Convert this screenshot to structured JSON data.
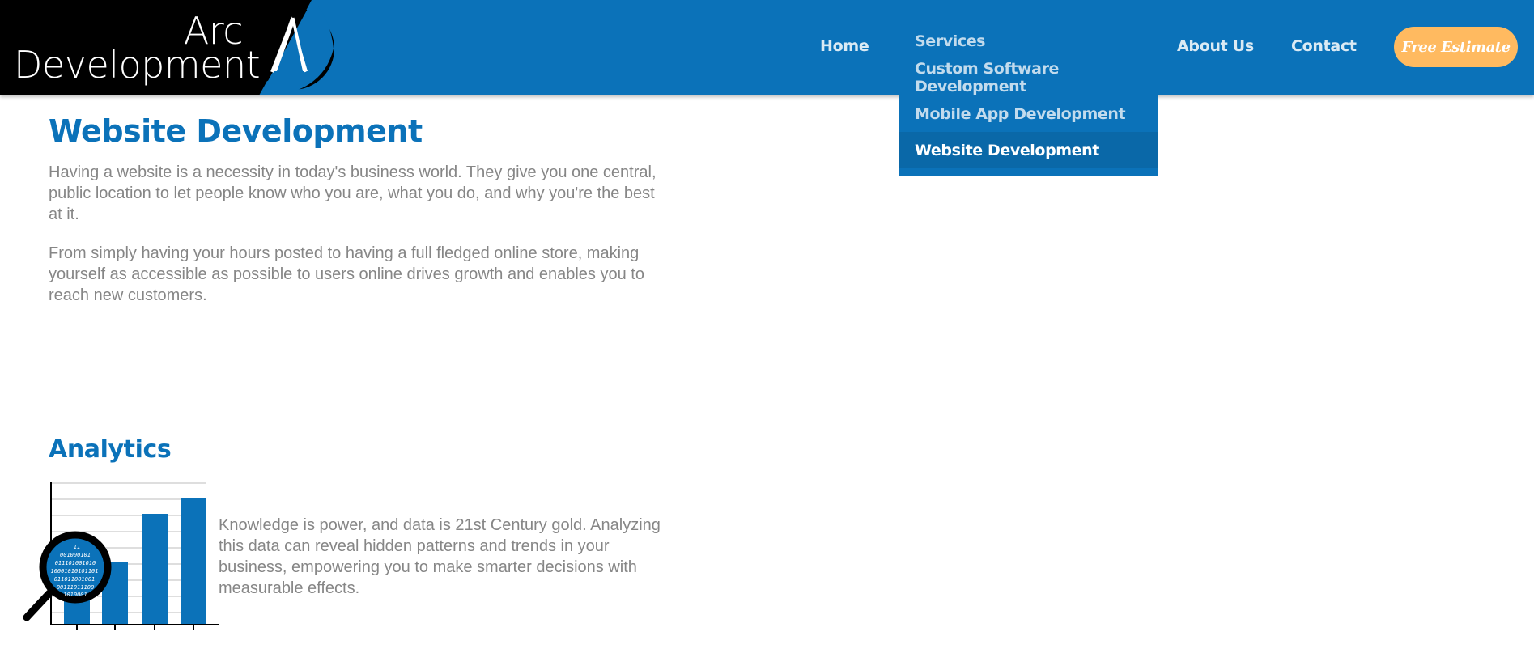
{
  "header": {
    "logo": {
      "line1": "Arc",
      "line2": "Development"
    },
    "tabs": [
      {
        "label": "Home"
      },
      {
        "label": "About Us"
      },
      {
        "label": "Contact"
      }
    ],
    "estimate_button": "Free Estimate"
  },
  "services_menu": {
    "items": [
      {
        "label": "Services"
      },
      {
        "label": "Custom Software Development"
      },
      {
        "label": "Mobile App Development"
      },
      {
        "label": "Website Development",
        "selected": true
      }
    ]
  },
  "main": {
    "title": "Website Development",
    "paragraphs": [
      "Having a website is a necessity in today's business world. They give you one central, public location to let people know who you are, what you do, and why you're the best at it.",
      "From simply having your hours posted to having a full fledged online store, making yourself as accessible as possible to users online drives growth and enables you to reach new customers."
    ],
    "analytics": {
      "heading": "Analytics",
      "text": "Knowledge is power, and data is 21st Century gold. Analyzing this data can reveal hidden patterns and trends in your business, empowering you to make smarter decisions with measurable effects.",
      "binary_lines": [
        "11",
        "001000101",
        "011101001010",
        "10001010101101",
        "011011001001",
        "00111011100",
        "1010001"
      ]
    }
  },
  "colors": {
    "primary": "#0b72b9",
    "accent": "#ffba60",
    "text_grey": "#868686",
    "selected_item": "#0a68a8"
  }
}
